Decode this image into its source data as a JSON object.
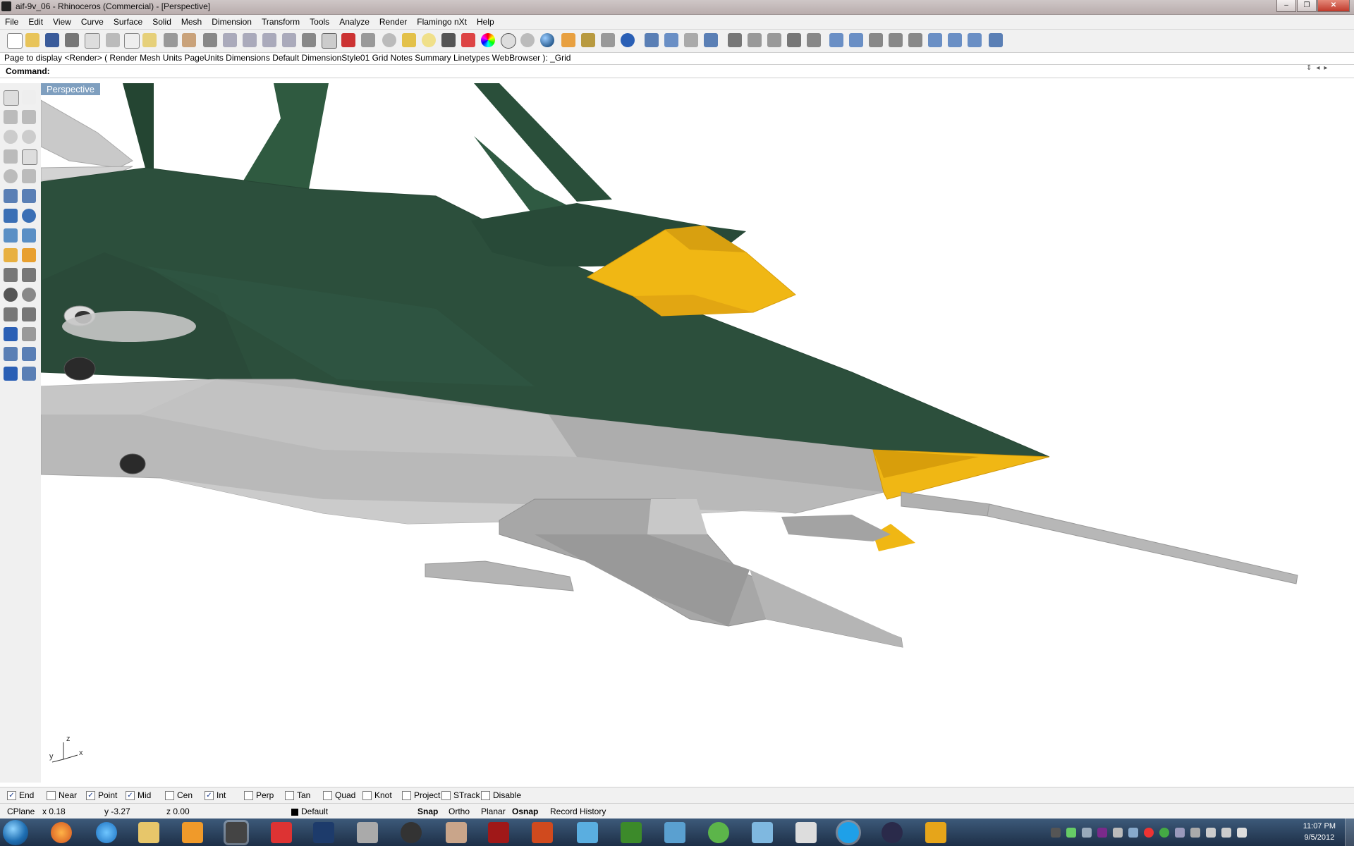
{
  "window": {
    "title": "aif-9v_06 - Rhinoceros (Commercial) - [Perspective]",
    "minimize": "–",
    "restore": "❐",
    "close": "✕"
  },
  "menu": [
    "File",
    "Edit",
    "View",
    "Curve",
    "Surface",
    "Solid",
    "Mesh",
    "Dimension",
    "Transform",
    "Tools",
    "Analyze",
    "Render",
    "Flamingo nXt",
    "Help"
  ],
  "command_history": "Page to display <Render> ( Render  Mesh  Units  PageUnits  Dimensions  Default  DimensionStyle01  Grid  Notes  Summary  Linetypes  WebBrowser ): _Grid",
  "command": {
    "label": "Command:",
    "value": ""
  },
  "viewport": {
    "label": "Perspective",
    "axis_z": "z",
    "axis_y": "y",
    "axis_x": "x"
  },
  "colors": {
    "fuselage_green": "#2c4f3c",
    "canopy_yellow": "#f0b714",
    "hull_gray": "#b8b8b8",
    "viewport_label_bg": "#7f9fbf"
  },
  "osnap": [
    {
      "label": "End",
      "checked": true
    },
    {
      "label": "Near",
      "checked": false
    },
    {
      "label": "Point",
      "checked": true
    },
    {
      "label": "Mid",
      "checked": true
    },
    {
      "label": "Cen",
      "checked": false
    },
    {
      "label": "Int",
      "checked": true
    },
    {
      "label": "Perp",
      "checked": false
    },
    {
      "label": "Tan",
      "checked": false
    },
    {
      "label": "Quad",
      "checked": false
    },
    {
      "label": "Knot",
      "checked": false
    },
    {
      "label": "Project",
      "checked": false
    },
    {
      "label": "STrack",
      "checked": false
    },
    {
      "label": "Disable",
      "checked": false
    }
  ],
  "status": {
    "cplane": "CPlane",
    "x": "x 0.18",
    "y": "y -3.27",
    "z": "z 0.00",
    "layer": "Default",
    "snap": "Snap",
    "ortho": "Ortho",
    "planar": "Planar",
    "osnap": "Osnap",
    "record_history": "Record History"
  },
  "clock": {
    "time": "11:07 PM",
    "date": "9/5/2012"
  }
}
